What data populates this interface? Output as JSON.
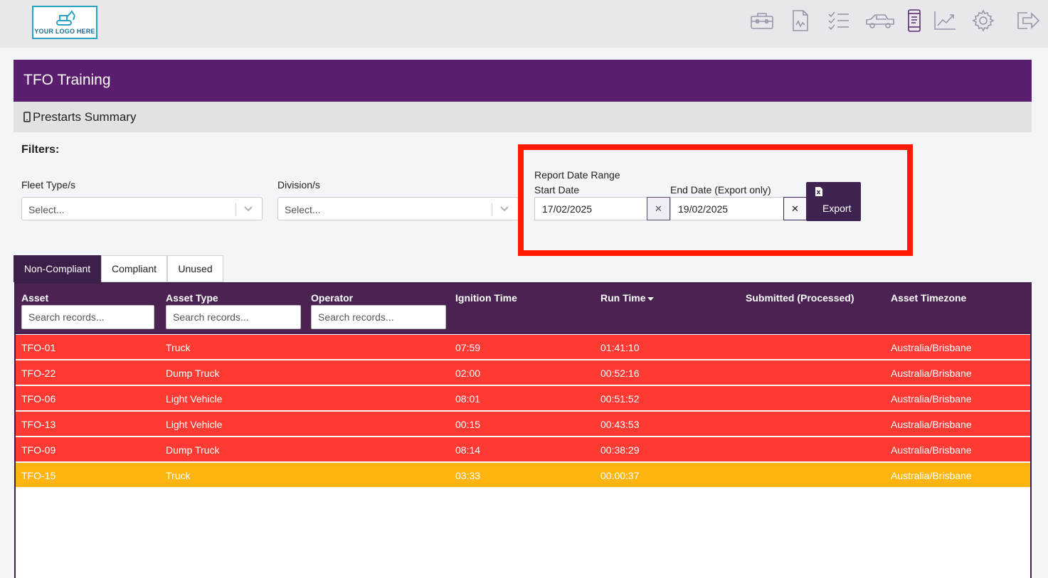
{
  "app": {
    "logo_text": "YOUR LOGO HERE",
    "page_title": "TFO Training",
    "section_title": "Prestarts Summary"
  },
  "nav_icons": [
    "toolbox-icon",
    "report-icon",
    "checklist-icon",
    "vehicle-icon",
    "mobile-icon",
    "chart-icon",
    "settings-icon",
    "logout-icon"
  ],
  "filters": {
    "heading": "Filters:",
    "fleet_label": "Fleet Type/s",
    "fleet_placeholder": "Select...",
    "division_label": "Division/s",
    "division_placeholder": "Select..."
  },
  "date_range": {
    "heading": "Report Date Range",
    "start_label": "Start Date",
    "start_value": "17/02/2025",
    "end_label": "End Date (Export only)",
    "end_value": "19/02/2025",
    "clear_glyph": "✕",
    "export_label": "Export"
  },
  "tabs": [
    {
      "label": "Non-Compliant",
      "active": true
    },
    {
      "label": "Compliant",
      "active": false
    },
    {
      "label": "Unused",
      "active": false
    }
  ],
  "table": {
    "columns": [
      "Asset",
      "Asset Type",
      "Operator",
      "Ignition Time",
      "Run Time",
      "Submitted (Processed)",
      "Asset Timezone"
    ],
    "search_placeholder": "Search records...",
    "rows": [
      {
        "asset": "TFO-01",
        "type": "Truck",
        "operator": "",
        "ignition": "07:59",
        "run": "01:41:10",
        "submitted": "",
        "tz": "Australia/Brisbane",
        "status": "red"
      },
      {
        "asset": "TFO-22",
        "type": "Dump Truck",
        "operator": "",
        "ignition": "02:00",
        "run": "00:52:16",
        "submitted": "",
        "tz": "Australia/Brisbane",
        "status": "red"
      },
      {
        "asset": "TFO-06",
        "type": "Light Vehicle",
        "operator": "",
        "ignition": "08:01",
        "run": "00:51:52",
        "submitted": "",
        "tz": "Australia/Brisbane",
        "status": "red"
      },
      {
        "asset": "TFO-13",
        "type": "Light Vehicle",
        "operator": "",
        "ignition": "00:15",
        "run": "00:43:53",
        "submitted": "",
        "tz": "Australia/Brisbane",
        "status": "red"
      },
      {
        "asset": "TFO-09",
        "type": "Dump Truck",
        "operator": "",
        "ignition": "08:14",
        "run": "00:38:29",
        "submitted": "",
        "tz": "Australia/Brisbane",
        "status": "red"
      },
      {
        "asset": "TFO-15",
        "type": "Truck",
        "operator": "",
        "ignition": "03:33",
        "run": "00:00:37",
        "submitted": "",
        "tz": "Australia/Brisbane",
        "status": "amber"
      }
    ]
  },
  "colors": {
    "brand_purple": "#5a1e6e",
    "header_purple": "#4a2352",
    "non_compliant_red": "#ff3a33",
    "warning_amber": "#ffb510",
    "highlight_red": "#ff1a00"
  }
}
